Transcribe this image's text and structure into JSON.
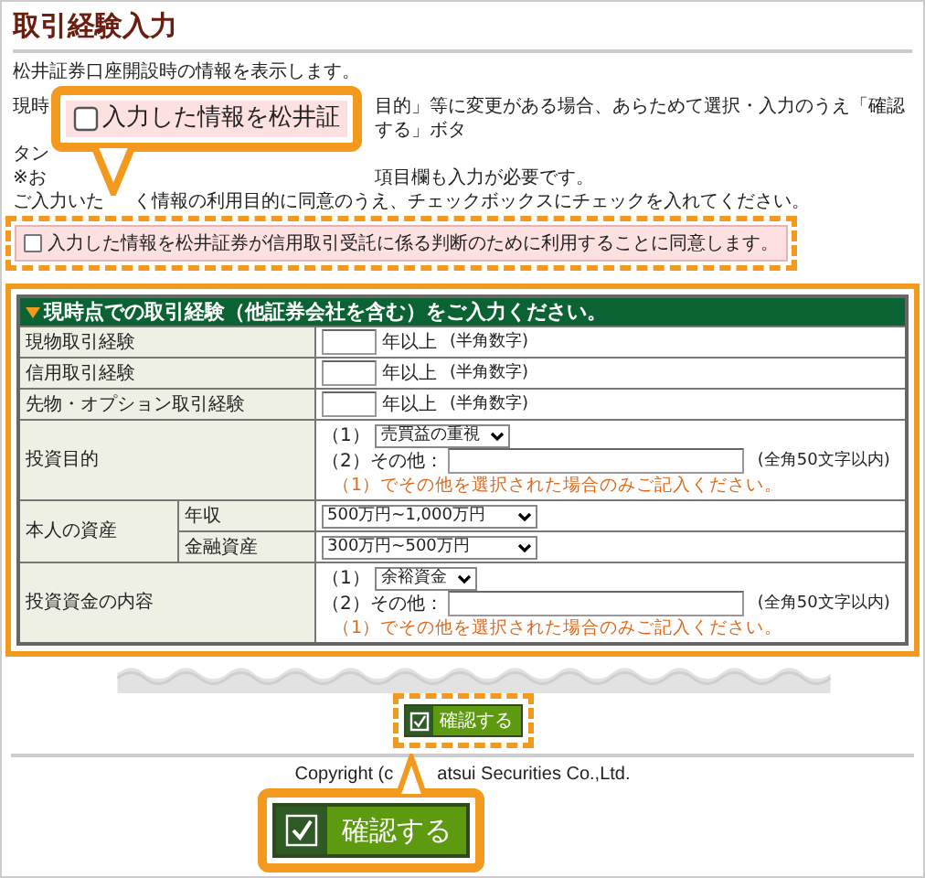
{
  "page_title": "取引経験入力",
  "intro": "松井証券口座開設時の情報を表示します。",
  "notice_lines": [
    {
      "left": "現時",
      "right": "目的」等に変更がある場合、あらためて選択・入力のうえ「確認する」ボタ"
    },
    {
      "left": "タン"
    },
    {
      "left": "※お",
      "right": "項目欄も入力が必要です。"
    },
    {
      "left": "ご入力いた",
      "right": "く情報の利用目的に同意のうえ、チェックボックスにチェックを入れてください。",
      "near": true
    }
  ],
  "consent": {
    "label": "入力した情報を松井証券が信用取引受託に係る判断のために利用することに同意します。",
    "checked": false,
    "highlighted": true
  },
  "form": {
    "heading": "現時点での取引経験（他証券会社を含む）をご入力ください。",
    "highlighted": true,
    "rows": [
      {
        "kind": "years",
        "label": "現物取引経験",
        "suffix": "年以上",
        "note": "(半角数字)"
      },
      {
        "kind": "years",
        "label": "信用取引経験",
        "suffix": "年以上",
        "note": "(半角数字)"
      },
      {
        "kind": "years",
        "label": "先物・オプション取引経験",
        "suffix": "年以上",
        "note": "(半角数字)"
      },
      {
        "kind": "purpose",
        "label": "投資目的",
        "select_prefix": "（1）",
        "select_value": "売買益の重視",
        "other_prefix": "（2）その他：",
        "limit": "(全角50文字以内)",
        "hint": "（1）でその他を選択された場合のみご記入ください。"
      },
      {
        "kind": "assets",
        "label": "本人の資産",
        "children": [
          {
            "label": "年収",
            "value": "500万円~1,000万円"
          },
          {
            "label": "金融資産",
            "value": "300万円~500万円"
          }
        ]
      },
      {
        "kind": "purpose",
        "label": "投資資金の内容",
        "select_prefix": "（1）",
        "select_value": "余裕資金",
        "other_prefix": "（2）その他：",
        "limit": "(全角50文字以内)",
        "hint": "（1）でその他を選択された場合のみご記入ください。"
      }
    ]
  },
  "confirm_button": {
    "label": "確認する",
    "highlighted": true
  },
  "copyright_parts": [
    "Copyright (c",
    "atsui Securities Co.,Ltd."
  ],
  "callouts": [
    {
      "kind": "consent",
      "text": "入力した情報を松井証"
    },
    {
      "kind": "button",
      "label": "確認する"
    }
  ]
}
